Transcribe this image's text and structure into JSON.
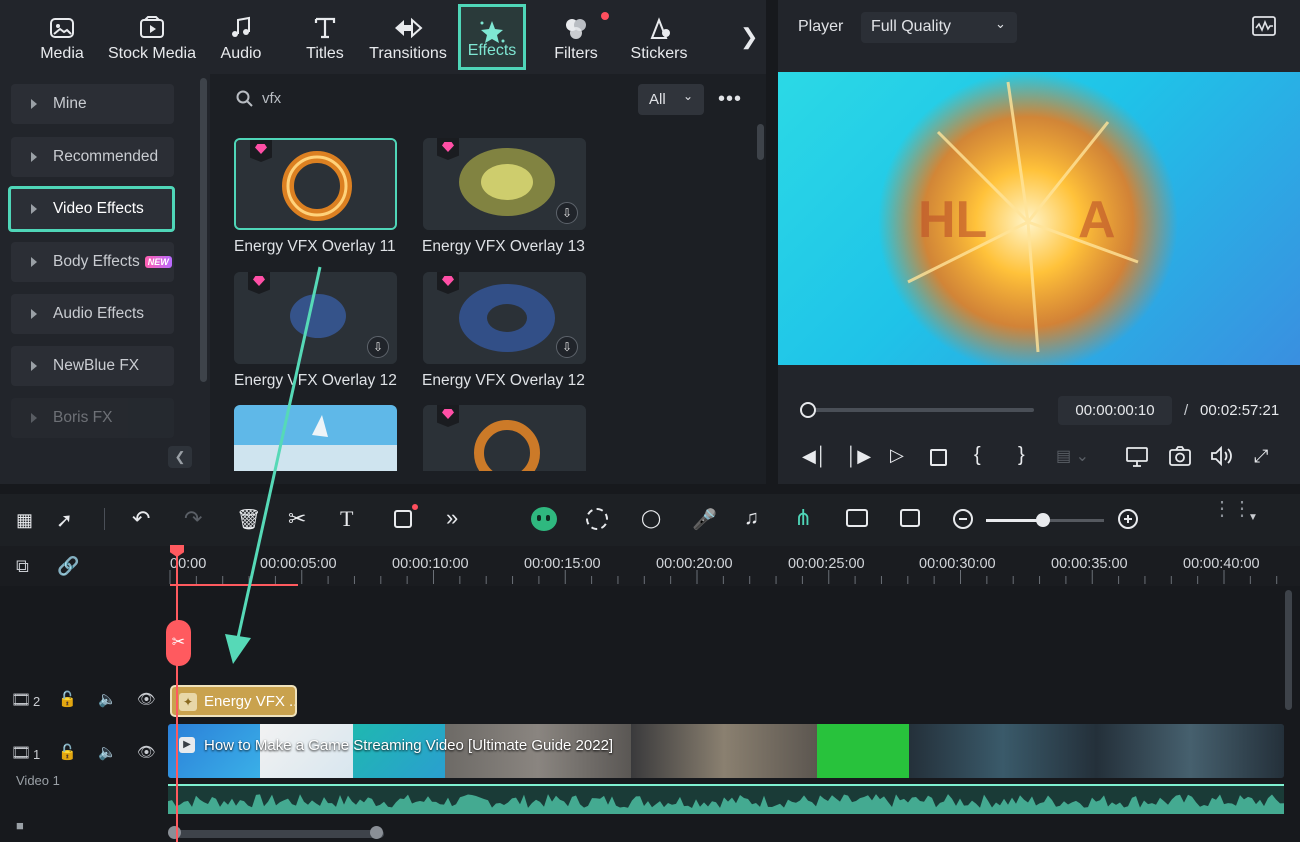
{
  "toolbar": {
    "tabs": [
      {
        "label": "Media",
        "icon": "media-icon"
      },
      {
        "label": "Stock Media",
        "icon": "stock-media-icon"
      },
      {
        "label": "Audio",
        "icon": "music-note-icon"
      },
      {
        "label": "Titles",
        "icon": "titles-icon"
      },
      {
        "label": "Transitions",
        "icon": "transitions-icon"
      },
      {
        "label": "Effects",
        "icon": "effects-star-icon",
        "active": true
      },
      {
        "label": "Filters",
        "icon": "filters-icon"
      },
      {
        "label": "Stickers",
        "icon": "stickers-icon"
      }
    ],
    "more_icon": "chevron-right-icon"
  },
  "categories": [
    {
      "label": "Mine"
    },
    {
      "label": "Recommended"
    },
    {
      "label": "Video Effects",
      "active": true
    },
    {
      "label": "Body Effects",
      "badge": "NEW"
    },
    {
      "label": "Audio Effects"
    },
    {
      "label": "NewBlue FX"
    },
    {
      "label": "Boris FX"
    }
  ],
  "search": {
    "value": "vfx",
    "filter": "All"
  },
  "effects": [
    {
      "label": "Energy VFX Overlay 11",
      "selected": true
    },
    {
      "label": "Energy VFX Overlay 13"
    },
    {
      "label": "Energy VFX Overlay 12"
    },
    {
      "label": "Energy VFX Overlay 12"
    }
  ],
  "player": {
    "label": "Player",
    "quality": "Full Quality",
    "current_time": "00:00:00:10",
    "separator": "/",
    "total_time": "00:02:57:21",
    "progress_fraction": 0.0
  },
  "timeline": {
    "ruler": [
      "00:00",
      "00:00:05:00",
      "00:00:10:00",
      "00:00:15:00",
      "00:00:20:00",
      "00:00:25:00",
      "00:00:30:00",
      "00:00:35:00",
      "00:00:40:00"
    ],
    "tracks": [
      {
        "number": "2"
      },
      {
        "number": "1",
        "name": "Video 1"
      }
    ],
    "effect_clip": "Energy VFX ...",
    "video_clip": "How to Make a Game Streaming Video [Ultimate Guide 2022]"
  },
  "colors": {
    "accent": "#4fd6b8",
    "playhead": "#ff5a5f",
    "fx_clip": "#c9a24e"
  }
}
